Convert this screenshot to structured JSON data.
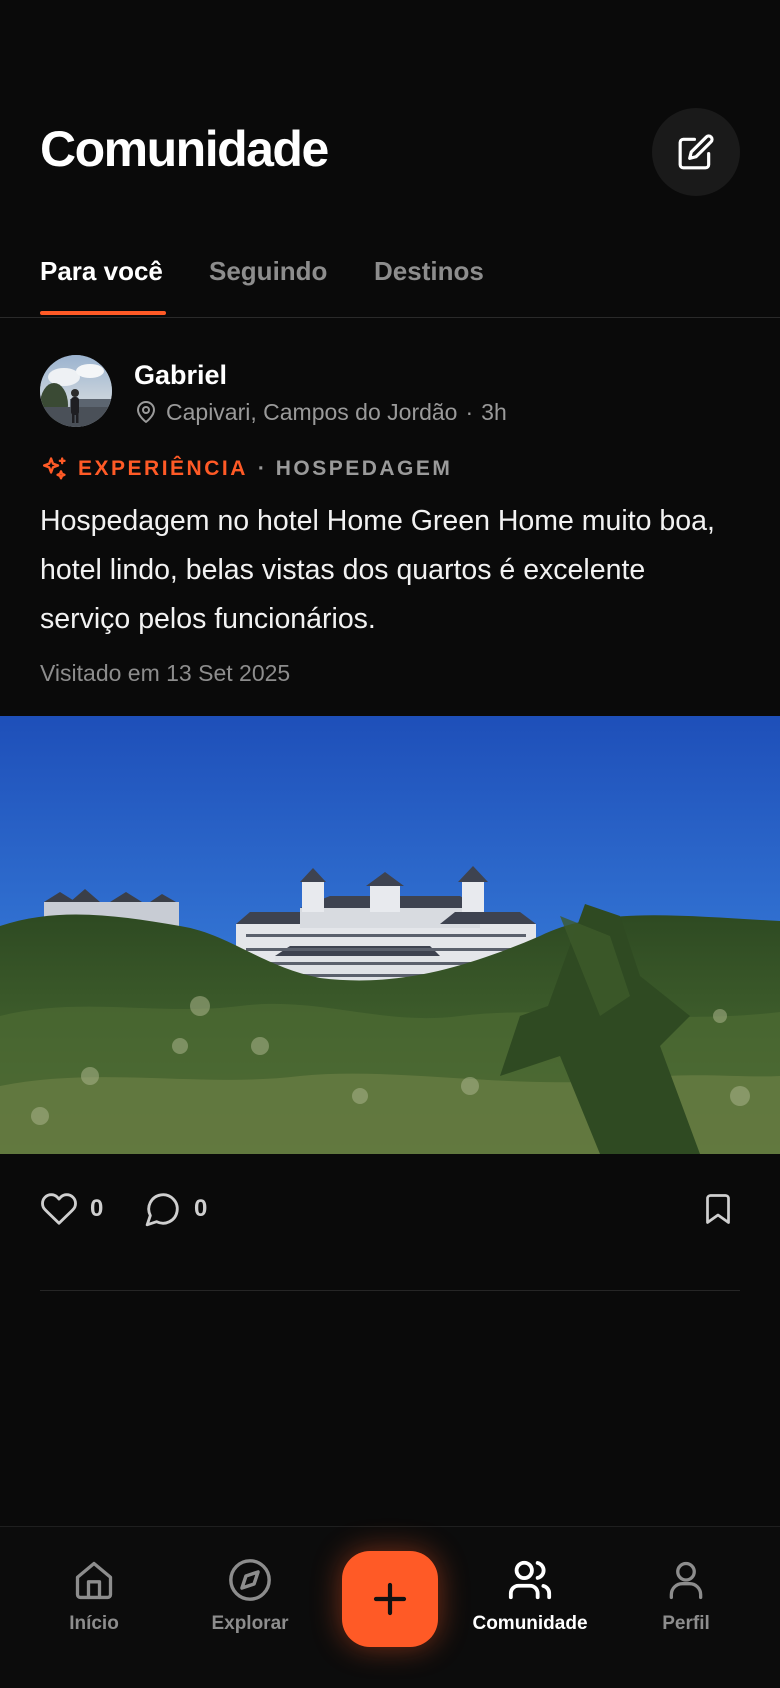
{
  "header": {
    "title": "Comunidade"
  },
  "tabs": [
    {
      "label": "Para você",
      "active": true
    },
    {
      "label": "Seguindo",
      "active": false
    },
    {
      "label": "Destinos",
      "active": false
    }
  ],
  "post": {
    "author": "Gabriel",
    "location": "Capivari, Campos do Jordão",
    "separator": "·",
    "time": "3h",
    "tag_primary": "EXPERIÊNCIA",
    "tag_secondary": "· HOSPEDAGEM",
    "text": "Hospedagem no hotel Home Green Home muito boa, hotel lindo, belas vistas dos quartos é excelente serviço pelos funcionários.",
    "visited": "Visitado em 13 Set 2025",
    "likes": "0",
    "comments": "0"
  },
  "nav": {
    "items": [
      {
        "label": "Início",
        "icon": "home-icon"
      },
      {
        "label": "Explorar",
        "icon": "compass-icon"
      },
      {
        "label": "Comunidade",
        "icon": "users-icon",
        "active": true
      },
      {
        "label": "Perfil",
        "icon": "user-icon"
      }
    ],
    "fab_icon": "plus-icon"
  },
  "colors": {
    "accent": "#ff5a26",
    "background": "#0a0a0a",
    "muted": "#8d8d8d"
  }
}
